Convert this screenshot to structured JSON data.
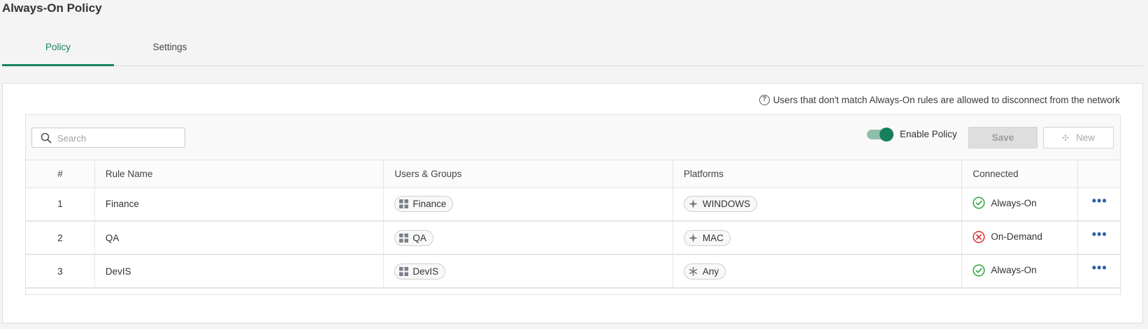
{
  "page": {
    "title": "Always-On Policy"
  },
  "tabs": [
    {
      "label": "Policy",
      "active": true
    },
    {
      "label": "Settings",
      "active": false
    }
  ],
  "notice": {
    "text": "Users that don't match Always-On rules are allowed to disconnect from the network",
    "icon": "help-circle-icon"
  },
  "toolbar": {
    "search_placeholder": "Search",
    "search_value": "",
    "enable_policy_label": "Enable Policy",
    "enable_policy_on": true,
    "save_label": "Save",
    "new_label": "New"
  },
  "table": {
    "columns": [
      "#",
      "Rule Name",
      "Users & Groups",
      "Platforms",
      "Connected"
    ],
    "rows": [
      {
        "num": "1",
        "rule": "Finance",
        "group": "Finance",
        "platform": "WINDOWS",
        "platform_icon": "sparkle-icon",
        "connected": "Always-On",
        "status": "ok"
      },
      {
        "num": "2",
        "rule": "QA",
        "group": "QA",
        "platform": "MAC",
        "platform_icon": "sparkle-icon",
        "connected": "On-Demand",
        "status": "error"
      },
      {
        "num": "3",
        "rule": "DevIS",
        "group": "DevIS",
        "platform": "Any",
        "platform_icon": "asterisk-icon",
        "connected": "Always-On",
        "status": "ok"
      }
    ]
  },
  "colors": {
    "accent": "#17855c",
    "ok": "#3aa845",
    "error": "#d9383a",
    "more_icon": "#2e5fa3"
  }
}
